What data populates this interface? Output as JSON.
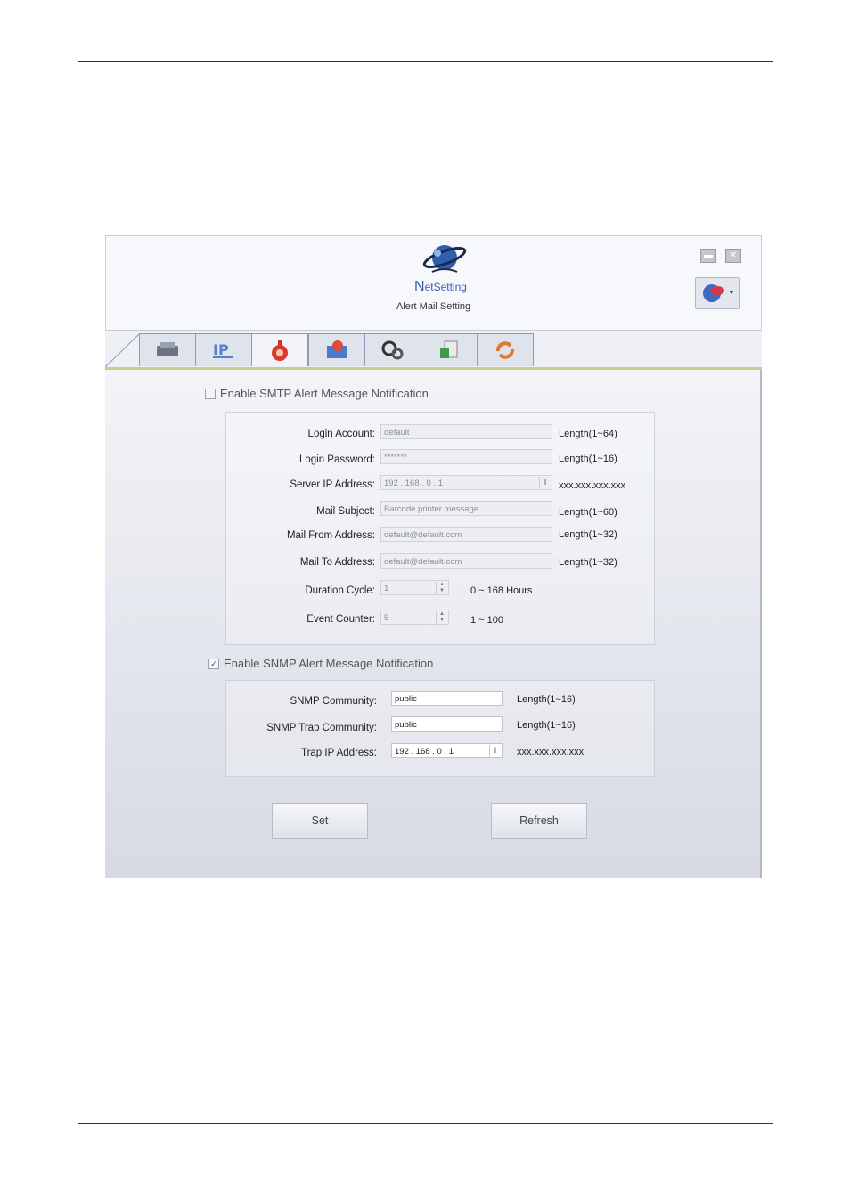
{
  "header": {
    "brand_first": "N",
    "brand_rest": "etSetting",
    "subtitle": "Alert Mail Setting"
  },
  "tabs": [
    {
      "icon": "printer-icon"
    },
    {
      "icon": "ip-network-icon"
    },
    {
      "icon": "alert-mail-icon",
      "active": true
    },
    {
      "icon": "alert-map-icon"
    },
    {
      "icon": "gears-icon"
    },
    {
      "icon": "file-transfer-icon"
    },
    {
      "icon": "refresh-arrows-icon"
    }
  ],
  "smtp": {
    "enable_label": "Enable SMTP Alert Message Notification",
    "enabled": false,
    "login_account": {
      "label": "Login Account:",
      "value": "default",
      "hint": "Length(1~64)"
    },
    "login_password": {
      "label": "Login Password:",
      "value": "*******",
      "hint": "Length(1~16)"
    },
    "server_ip": {
      "label": "Server IP Address:",
      "value": "192 . 168 . 0 . 1",
      "hint": "xxx.xxx.xxx.xxx"
    },
    "mail_subject": {
      "label": "Mail Subject:",
      "value": "Barcode printer message",
      "hint": "Length(1~60)"
    },
    "mail_from": {
      "label": "Mail From Address:",
      "value": "default@default.com",
      "hint": "Length(1~32)"
    },
    "mail_to": {
      "label": "Mail To Address:",
      "value": "default@default.com",
      "hint": "Length(1~32)"
    },
    "duration_cycle": {
      "label": "Duration Cycle:",
      "value": "1",
      "hint": "0 ~ 168 Hours"
    },
    "event_counter": {
      "label": "Event Counter:",
      "value": "5",
      "hint": "1 ~ 100"
    }
  },
  "snmp": {
    "enable_label": "Enable SNMP Alert Message Notification",
    "enabled": true,
    "community": {
      "label": "SNMP Community:",
      "value": "public",
      "hint": "Length(1~16)"
    },
    "trap_community": {
      "label": "SNMP Trap Community:",
      "value": "public",
      "hint": "Length(1~16)"
    },
    "trap_ip": {
      "label": "Trap IP Address:",
      "value": "192 . 168 . 0 . 1",
      "hint": "xxx.xxx.xxx.xxx"
    }
  },
  "buttons": {
    "set": "Set",
    "refresh": "Refresh"
  },
  "colors": {
    "accent": "#3a5cb8",
    "tab_border": "#8f9bb5",
    "background": "#eef0f6"
  }
}
